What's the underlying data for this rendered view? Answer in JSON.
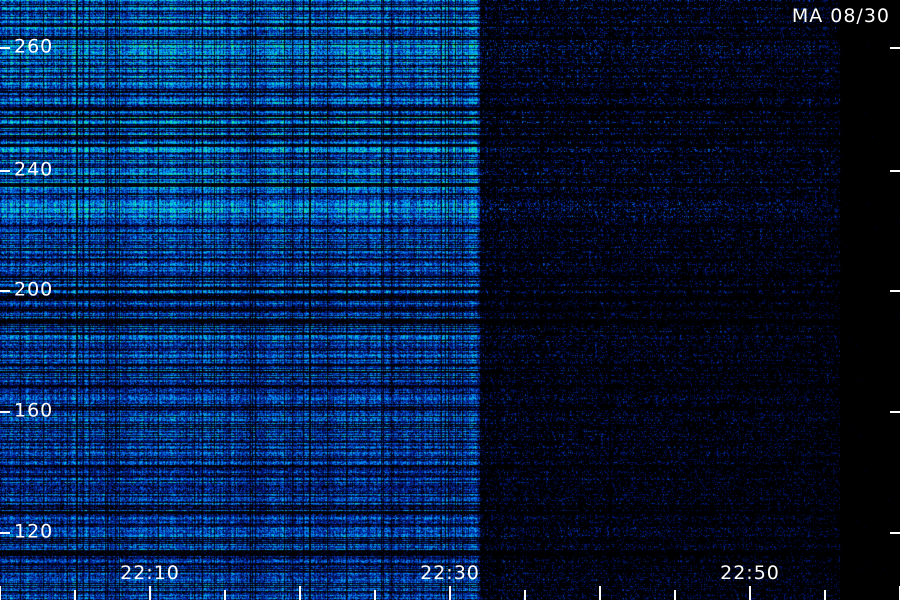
{
  "station": "MA 08/30",
  "y_axis_labels": [
    "260",
    "240",
    "200",
    "160",
    "120"
  ],
  "x_axis_labels": [
    "22:10",
    "22:30",
    "22:50"
  ],
  "colors": {
    "background": "#000000",
    "low": "#0a1a6a",
    "mid": "#1a6cff",
    "high": "#00e0c0",
    "peak": "#2aff40",
    "text": "#ffffff"
  }
}
